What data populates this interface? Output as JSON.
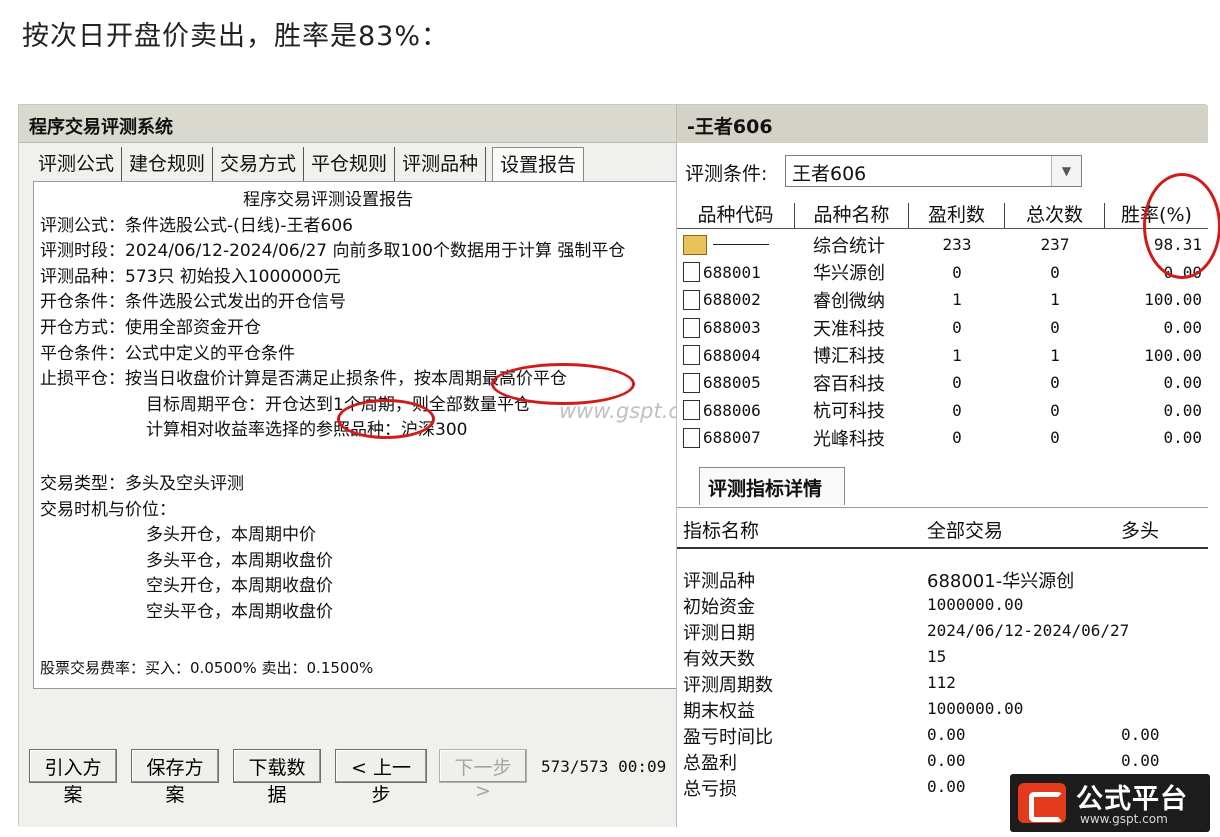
{
  "heading": "按次日开盘价卖出，胜率是83%：",
  "left": {
    "title": "程序交易评测系统",
    "tabs": [
      "评测公式",
      "建仓规则",
      "交易方式",
      "平仓规则",
      "评测品种",
      "设置报告"
    ],
    "report": {
      "title": "程序交易评测设置报告",
      "lines": [
        "评测公式：条件选股公式-(日线)-王者606",
        "评测时段：2024/06/12-2024/06/27 向前多取100个数据用于计算 强制平仓",
        "评测品种：573只 初始投入1000000元",
        "开仓条件：条件选股公式发出的开仓信号",
        "开仓方式：使用全部资金开仓",
        "平仓条件：公式中定义的平仓条件",
        "止损平仓：按当日收盘价计算是否满足止损条件，按本周期最高价平仓"
      ],
      "sub_lines": [
        "目标周期平仓：开仓达到1个周期，则全部数量平仓",
        "计算相对收益率选择的参照品种：沪深300"
      ],
      "trade_type": "交易类型：多头及空头评测",
      "timing_label": "交易时机与价位：",
      "timing": [
        "多头开仓，本周期中价",
        "多头平仓，本周期收盘价",
        "空头开仓，本周期收盘价",
        "空头平仓，本周期收盘价"
      ],
      "fee_line": "股票交易费率：买入：0.0500%  卖出：0.1500%"
    },
    "watermark": "www.gspt.com",
    "buttons": {
      "import": "引入方案",
      "save": "保存方案",
      "download": "下载数据",
      "prev": "< 上一步",
      "next": "下一步 >"
    },
    "status": "573/573 00:09"
  },
  "right": {
    "title": "-王者606",
    "condition_label": "评测条件:",
    "condition_value": "王者606",
    "columns": [
      "品种代码",
      "品种名称",
      "盈利数",
      "总次数",
      "胜率(%)"
    ],
    "summary_row": {
      "name": "综合统计",
      "wins": "233",
      "total": "237",
      "rate": "98.31"
    },
    "rows": [
      {
        "code": "688001",
        "name": "华兴源创",
        "wins": "0",
        "total": "0",
        "rate": "0.00"
      },
      {
        "code": "688002",
        "name": "睿创微纳",
        "wins": "1",
        "total": "1",
        "rate": "100.00"
      },
      {
        "code": "688003",
        "name": "天准科技",
        "wins": "0",
        "total": "0",
        "rate": "0.00"
      },
      {
        "code": "688004",
        "name": "博汇科技",
        "wins": "1",
        "total": "1",
        "rate": "100.00"
      },
      {
        "code": "688005",
        "name": "容百科技",
        "wins": "0",
        "total": "0",
        "rate": "0.00"
      },
      {
        "code": "688006",
        "name": "杭可科技",
        "wins": "0",
        "total": "0",
        "rate": "0.00"
      },
      {
        "code": "688007",
        "name": "光峰科技",
        "wins": "0",
        "total": "0",
        "rate": "0.00"
      }
    ],
    "detail_tab": "评测指标详情",
    "detail_columns": [
      "指标名称",
      "全部交易",
      "多头"
    ],
    "metrics": [
      {
        "label": "评测品种",
        "all": "688001-华兴源创",
        "long": ""
      },
      {
        "label": "初始资金",
        "all": "1000000.00",
        "long": ""
      },
      {
        "label": "评测日期",
        "all": "2024/06/12-2024/06/27",
        "long": ""
      },
      {
        "label": "有效天数",
        "all": "15",
        "long": ""
      },
      {
        "label": "评测周期数",
        "all": "112",
        "long": ""
      },
      {
        "label": "期末权益",
        "all": "1000000.00",
        "long": ""
      },
      {
        "label": "盈亏时间比",
        "all": "0.00",
        "long": "0.00"
      },
      {
        "label": "总盈利",
        "all": "0.00",
        "long": "0.00"
      },
      {
        "label": "总亏损",
        "all": "0.00",
        "long": ""
      }
    ]
  },
  "logo": {
    "name": "公式平台",
    "url": "www.gspt.com"
  },
  "colors": {
    "annotation_red": "#d11a1a",
    "logo_red": "#e33a1c",
    "title_bar": "#d9d9d0"
  }
}
